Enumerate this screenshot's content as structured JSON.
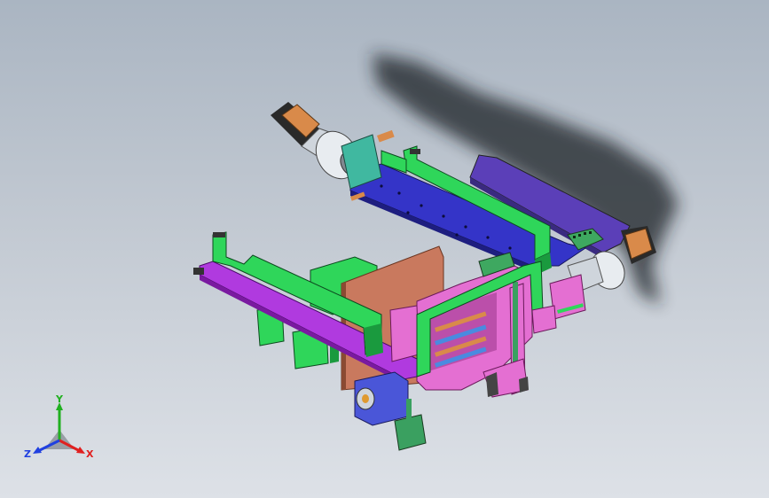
{
  "colors": {
    "background_top": "#aab5c2",
    "background_bottom": "#dde1e7",
    "frame_green": "#2fd65a",
    "rail_purple": "#b03adf",
    "plate_blue": "#3434c8",
    "plate_indigo": "#5b3fb8",
    "panel_brown": "#c9795e",
    "frame_pink": "#e46fd2",
    "motor_orange": "#d98a4a",
    "axis_x": "#e02020",
    "axis_y": "#20b020",
    "axis_z": "#2040e0"
  },
  "triad": {
    "x_label": "X",
    "y_label": "Y",
    "z_label": "Z"
  }
}
